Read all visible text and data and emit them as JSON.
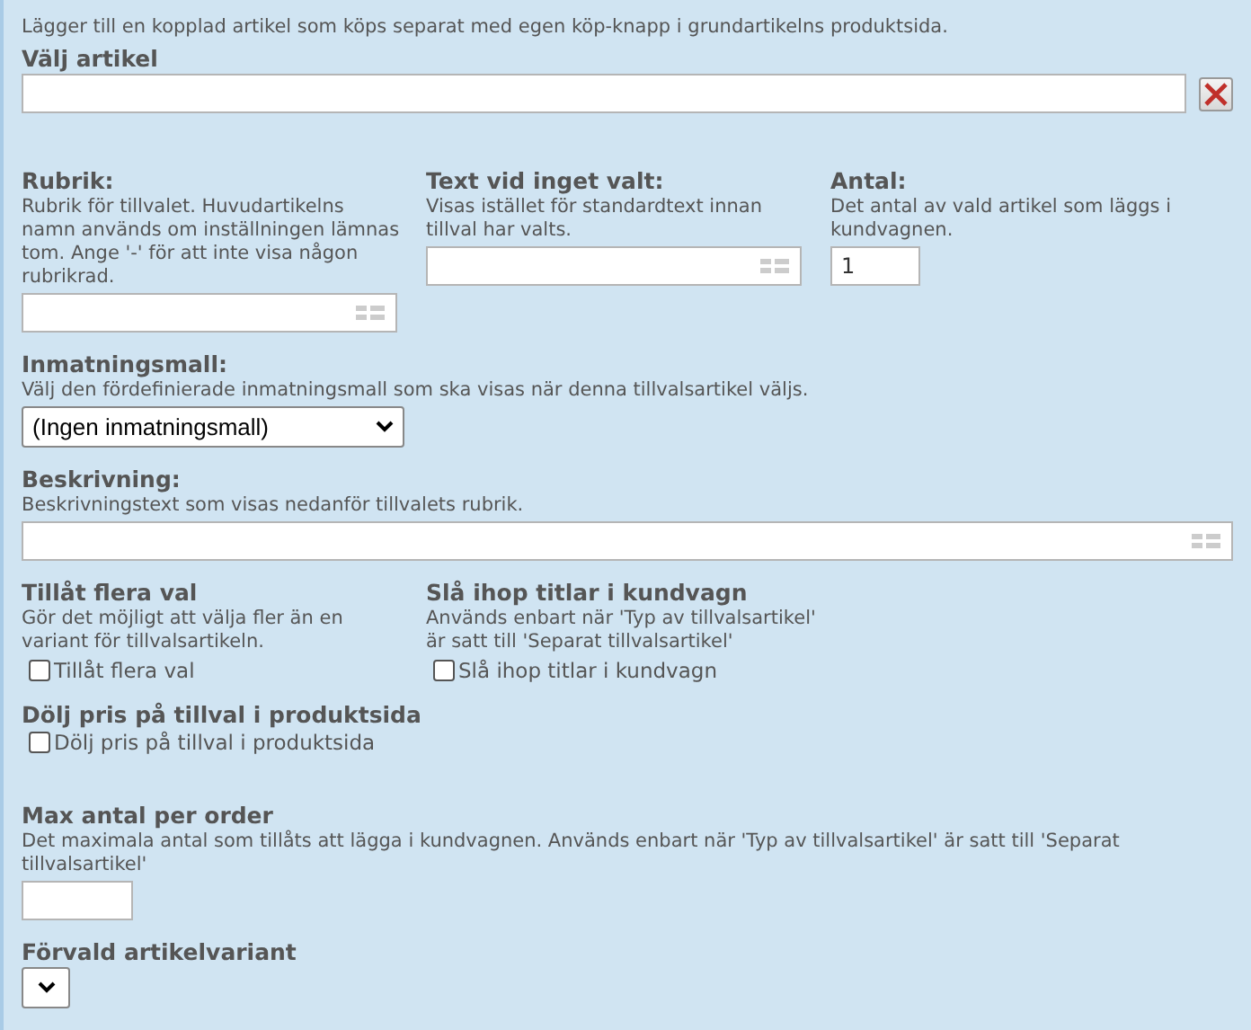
{
  "intro": "Lägger till en kopplad artikel som köps separat med egen köp-knapp i grundartikelns produktsida.",
  "rows": [
    [
      {
        "label": "Välj artikel",
        "kind": "picker"
      }
    ],
    [
      {
        "label": "Rubrik:",
        "hint": "Rubrik för tillvalet. Huvudartikelns namn används om inställningen lämnas tom. Ange '-' för att inte visa någon rubrikrad.",
        "kind": "text"
      },
      {
        "label": "Text vid inget valt:",
        "hint": "Visas istället för standardtext innan tillval har valts.",
        "kind": "text"
      },
      {
        "label": "Antal:",
        "hint": "Det antal av vald artikel som läggs i kundvagnen.",
        "kind": "number",
        "value": "1"
      }
    ],
    [
      {
        "label": "Inmatningsmall:",
        "hint": "Välj den fördefinierade inmatningsmall som ska visas när denna tillvalsartikel väljs.",
        "kind": "select",
        "value": "(Ingen inmatningsmall)"
      }
    ],
    [
      {
        "label": "Beskrivning:",
        "hint": "Beskrivningstext som visas nedanför tillvalets rubrik.",
        "kind": "text"
      }
    ],
    [
      {
        "label": "Tillåt flera val",
        "hint": "Gör det möjligt att välja fler än en variant för tillvalsartikeln.",
        "kind": "checkbox",
        "text": "Tillåt flera val",
        "checked": false
      },
      {
        "label": "Slå ihop titlar i kundvagn",
        "hint": "Används enbart när 'Typ av tillvalsartikel' är satt till 'Separat tillvalsartikel'",
        "kind": "checkbox",
        "text": "Slå ihop titlar i kundvagn",
        "checked": false
      }
    ],
    [
      {
        "label": "Dölj pris på tillval i produktsida",
        "kind": "checkbox",
        "text": "Dölj pris på tillval i produktsida",
        "checked": false
      }
    ],
    [
      {
        "label": "Max antal per order",
        "hint": "Det maximala antal som tillåts att lägga i kundvagnen. Används enbart när 'Typ av tillvalsartikel' är satt till 'Separat tillvalsartikel'",
        "kind": "number"
      }
    ],
    [
      {
        "label": "Förvald artikelvariant",
        "kind": "select"
      }
    ]
  ]
}
